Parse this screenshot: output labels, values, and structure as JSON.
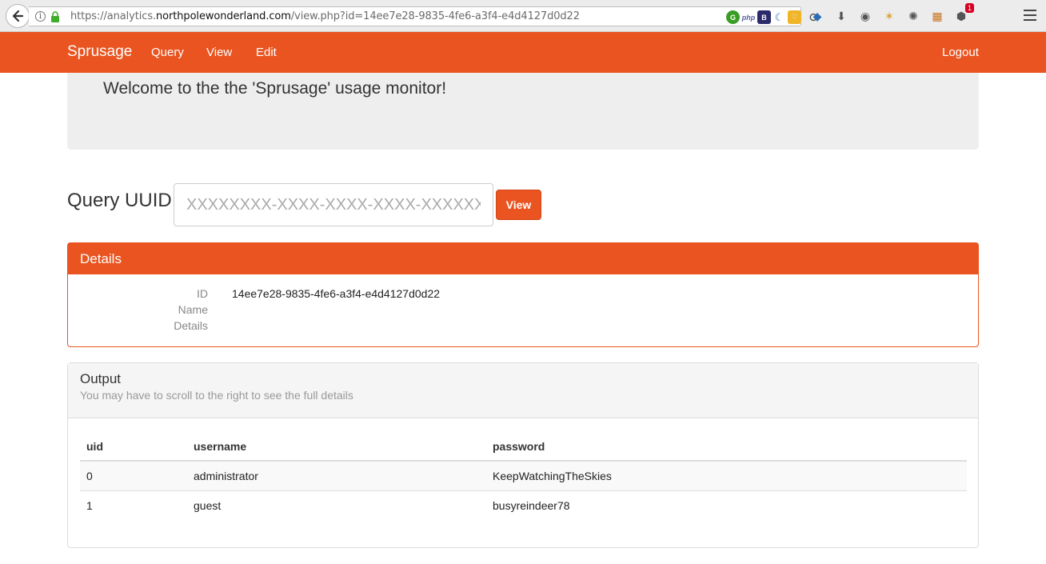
{
  "browser": {
    "url_prefix": "https://analytics.",
    "url_domain": "northpolewonderland.com",
    "url_path": "/view.php?id=14ee7e28-9835-4fe6-a3f4-e4d4127d0d22",
    "notification_count": "1"
  },
  "navbar": {
    "brand": "Sprusage",
    "items": [
      "Query",
      "View",
      "Edit"
    ],
    "logout": "Logout",
    "color": "#e95420"
  },
  "jumbotron": {
    "welcome": "Welcome to the the 'Sprusage' usage monitor!"
  },
  "query": {
    "label": "Query UUID",
    "placeholder": "XXXXXXXX-XXXX-XXXX-XXXX-XXXXXXXXXX",
    "button": "View"
  },
  "details": {
    "heading": "Details",
    "rows": [
      {
        "label": "ID",
        "value": "14ee7e28-9835-4fe6-a3f4-e4d4127d0d22"
      },
      {
        "label": "Name",
        "value": ""
      },
      {
        "label": "Details",
        "value": ""
      }
    ]
  },
  "output": {
    "title": "Output",
    "subtitle": "You may have to scroll to the right to see the full details",
    "columns": [
      "uid",
      "username",
      "password"
    ],
    "rows": [
      [
        "0",
        "administrator",
        "KeepWatchingTheSkies"
      ],
      [
        "1",
        "guest",
        "busyreindeer78"
      ]
    ]
  }
}
